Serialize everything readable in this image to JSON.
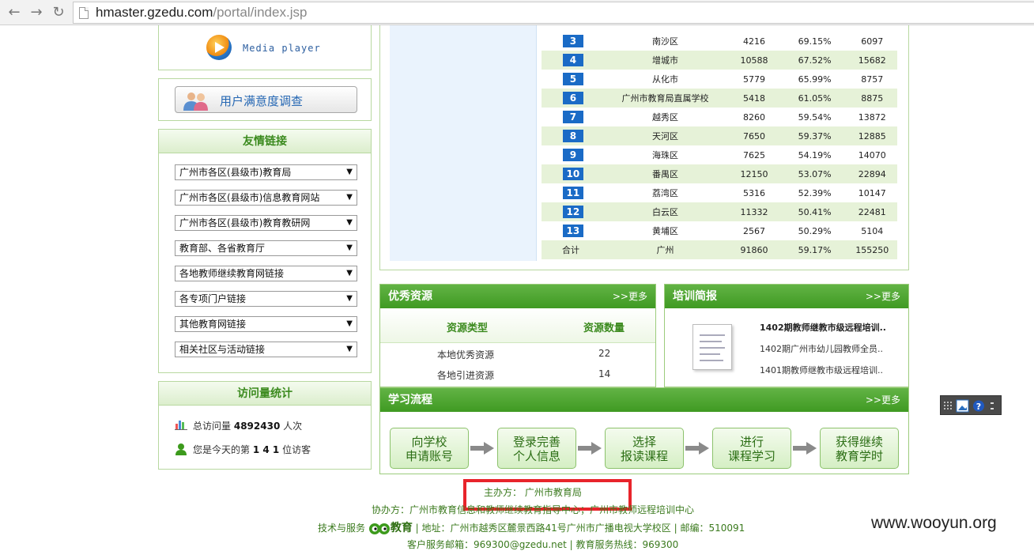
{
  "browser": {
    "url_host": "hmaster.gzedu.com",
    "url_path": "/portal/index.jsp",
    "back_glyph": "←",
    "forward_glyph": "→",
    "reload_glyph": "↻"
  },
  "sidebar": {
    "media_player_label": "Media player",
    "survey_label": "用户满意度调查",
    "links_title": "友情链接",
    "link_selects": [
      "广州市各区(县级市)教育局",
      "广州市各区(县级市)信息教育网站",
      "广州市各区(县级市)教育教研网",
      "教育部、各省教育厅",
      "各地教师继续教育网链接",
      "各专项门户链接",
      "其他教育网链接",
      "相关社区与活动链接"
    ],
    "select_arrow": "▼",
    "visits_title": "访问量统计",
    "total_visits_prefix": "总访问量",
    "total_visits_value": "4892430",
    "total_visits_suffix": "人次",
    "today_prefix": "您是今天的第",
    "today_value": "1 4 1",
    "today_suffix": "位访客"
  },
  "ranking": {
    "rows": [
      {
        "no": "3",
        "name": "南沙区",
        "a": "4216",
        "pct": "69.15%",
        "b": "6097"
      },
      {
        "no": "4",
        "name": "增城市",
        "a": "10588",
        "pct": "67.52%",
        "b": "15682"
      },
      {
        "no": "5",
        "name": "从化市",
        "a": "5779",
        "pct": "65.99%",
        "b": "8757"
      },
      {
        "no": "6",
        "name": "广州市教育局直属学校",
        "a": "5418",
        "pct": "61.05%",
        "b": "8875"
      },
      {
        "no": "7",
        "name": "越秀区",
        "a": "8260",
        "pct": "59.54%",
        "b": "13872"
      },
      {
        "no": "8",
        "name": "天河区",
        "a": "7650",
        "pct": "59.37%",
        "b": "12885"
      },
      {
        "no": "9",
        "name": "海珠区",
        "a": "7625",
        "pct": "54.19%",
        "b": "14070"
      },
      {
        "no": "10",
        "name": "番禺区",
        "a": "12150",
        "pct": "53.07%",
        "b": "22894"
      },
      {
        "no": "11",
        "name": "荔湾区",
        "a": "5316",
        "pct": "52.39%",
        "b": "10147"
      },
      {
        "no": "12",
        "name": "白云区",
        "a": "11332",
        "pct": "50.41%",
        "b": "22481"
      },
      {
        "no": "13",
        "name": "黄埔区",
        "a": "2567",
        "pct": "50.29%",
        "b": "5104"
      }
    ],
    "total": {
      "label": "合计",
      "name": "广州",
      "a": "91860",
      "pct": "59.17%",
      "b": "155250"
    }
  },
  "resources": {
    "title": "优秀资源",
    "more": ">>更多",
    "col_type": "资源类型",
    "col_count": "资源数量",
    "rows": [
      {
        "type": "本地优秀资源",
        "count": "22"
      },
      {
        "type": "各地引进资源",
        "count": "14"
      }
    ]
  },
  "training": {
    "title": "培训简报",
    "more": ">>更多",
    "items": [
      "1402期教师继教市级远程培训..",
      "1402期广州市幼儿园教师全员..",
      "1401期教师继教市级远程培训.."
    ]
  },
  "flow": {
    "title": "学习流程",
    "more": ">>更多",
    "steps": [
      {
        "line1": "向学校",
        "line2": "申请账号"
      },
      {
        "line1": "登录完善",
        "line2": "个人信息"
      },
      {
        "line1": "选择",
        "line2": "报读课程"
      },
      {
        "line1": "进行",
        "line2": "课程学习"
      },
      {
        "line1": "获得继续",
        "line2": "教育学时"
      }
    ]
  },
  "footer": {
    "host": "主办方： 广州市教育局",
    "co_host": "协办方：广州市教育信息和教师继续教育指导中心；广州市教师远程培训中心",
    "tech_prefix": "技术与服务",
    "tech_logo_text": "教育",
    "address": "| 地址：广州市越秀区麓景西路41号广州市广播电视大学校区 | 邮编：510091",
    "service": "客户服务邮箱：969300@gzedu.net | 教育服务热线：969300"
  },
  "watermark": "www.wooyun.org"
}
